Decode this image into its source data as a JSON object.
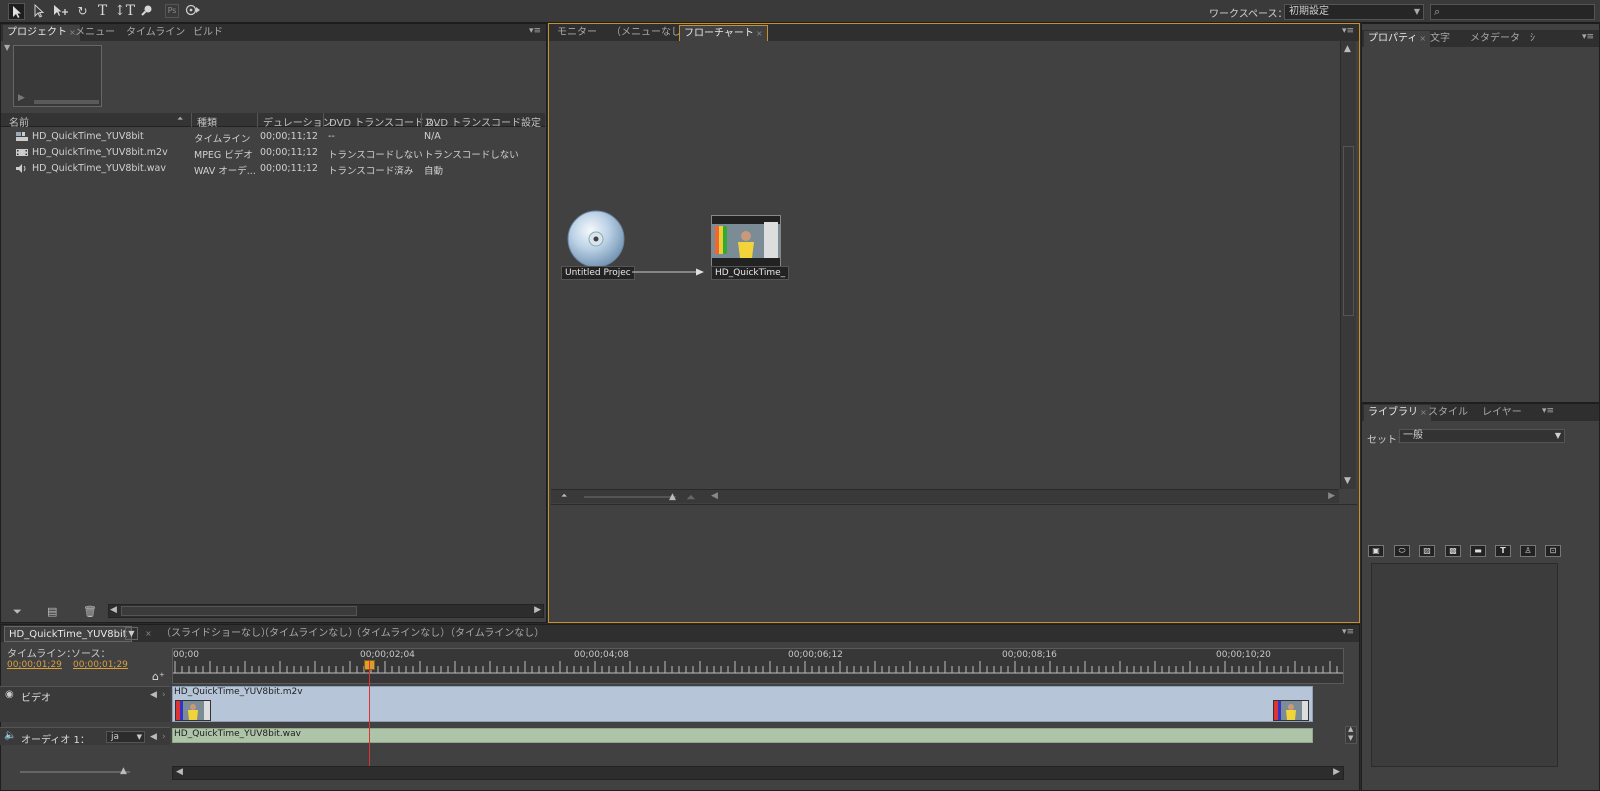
{
  "toolbar": {
    "tools": [
      "selection-tool",
      "direct-select-tool",
      "move-tool",
      "rotate-tool",
      "text-tool",
      "vertical-text-tool",
      "zoom-tool",
      "photoshop-button",
      "preview-button"
    ],
    "ps_label": "Ps",
    "workspace_label": "ワークスペース：",
    "workspace_value": "初期設定"
  },
  "project_panel": {
    "tabs": [
      {
        "label": "プロジェクト",
        "active": true
      },
      {
        "label": "メニュー",
        "active": false
      },
      {
        "label": "タイムライン",
        "active": false
      },
      {
        "label": "ビルド",
        "active": false
      }
    ],
    "columns": [
      "名前",
      "種類",
      "デュレーション",
      "DVD トランスコードス...",
      "DVD トランスコード設定"
    ],
    "rows": [
      {
        "icon": "timeline-icon",
        "name": "HD_QuickTime_YUV8bit",
        "type": "タイムライン",
        "duration": "00;00;11;12",
        "status": "--",
        "setting": "N/A"
      },
      {
        "icon": "video-file-icon",
        "name": "HD_QuickTime_YUV8bit.m2v",
        "type": "MPEG ビデオ",
        "duration": "00;00;11;12",
        "status": "トランスコードしない",
        "setting": "トランスコードしない"
      },
      {
        "icon": "audio-file-icon",
        "name": "HD_QuickTime_YUV8bit.wav",
        "type": "WAV オーデ...",
        "duration": "00;00;11;12",
        "status": "トランスコード済み",
        "setting": "自動"
      }
    ]
  },
  "flow_panel": {
    "tabs": [
      {
        "label": "モニター",
        "active": false
      },
      {
        "label": "（メニューなし）",
        "active": false
      },
      {
        "label": "フローチャート",
        "active": true
      }
    ],
    "nodes": [
      {
        "label": "Untitled Projec",
        "icon": "disc-icon"
      },
      {
        "label": "HD_QuickTime_",
        "icon": "video-thumbnail"
      }
    ]
  },
  "properties_panel": {
    "tabs": [
      {
        "label": "プロパティ",
        "active": true
      },
      {
        "label": "文字",
        "active": false
      },
      {
        "label": "メタデータ",
        "active": false
      },
      {
        "label": "ｼ",
        "active": false
      }
    ]
  },
  "library_panel": {
    "tabs": [
      {
        "label": "ライブラリ",
        "active": true
      },
      {
        "label": "スタイル",
        "active": false
      },
      {
        "label": "レイヤー",
        "active": false
      }
    ],
    "set_label": "セット：",
    "set_value": "一般",
    "icons": [
      "button-icon",
      "oval-button-icon",
      "image-icon",
      "pattern-icon",
      "folder-icon",
      "text-icon",
      "brush-icon",
      "import-icon"
    ]
  },
  "timeline_panel": {
    "tabs": [
      {
        "label": "HD_QuickTime_YUV8bit",
        "active": true
      },
      {
        "label": "（スライドショーなし）",
        "active": false
      },
      {
        "label": "（タイムラインなし）",
        "active": false
      },
      {
        "label": "（タイムラインなし）",
        "active": false
      },
      {
        "label": "（タイムラインなし）",
        "active": false
      }
    ],
    "timeline_label": "タイムライン：",
    "source_label": "ソース：",
    "timeline_tc": "00;00;01;29",
    "source_tc": "00;00;01;29",
    "ruler_labels": [
      "00;00",
      "00;00;02;04",
      "00;00;04;08",
      "00;00;06;12",
      "00;00;08;16",
      "00;00;10;20"
    ],
    "video_track_label": "ビデオ",
    "audio_track_label": "オーディオ 1：",
    "audio_lang": "ja",
    "video_clip": "HD_QuickTime_YUV8bit.m2v",
    "audio_clip": "HD_QuickTime_YUV8bit.wav"
  },
  "colors": {
    "accent_frame": "#c8922a",
    "playhead": "#e03030",
    "timecode": "#d8a040",
    "video_clip": "#b6c6d8",
    "audio_clip": "#aec4a8"
  }
}
